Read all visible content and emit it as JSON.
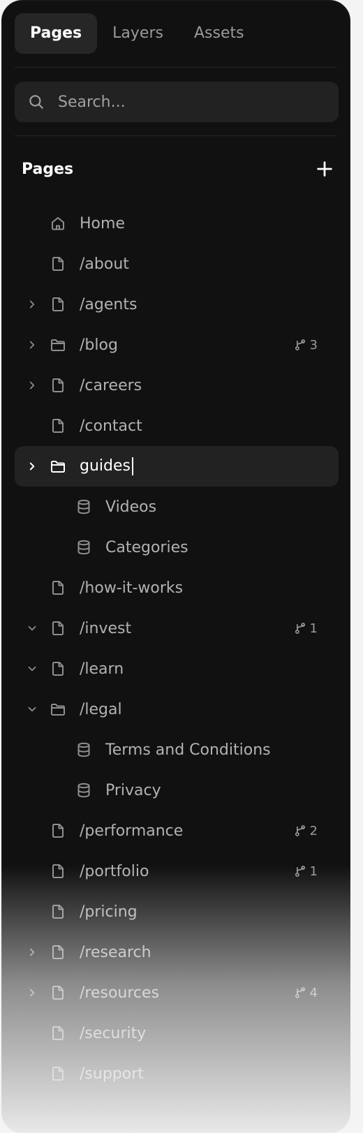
{
  "tabs": {
    "pages": "Pages",
    "layers": "Layers",
    "assets": "Assets"
  },
  "search": {
    "placeholder": "Search..."
  },
  "section": {
    "title": "Pages"
  },
  "items": {
    "home": {
      "label": "Home"
    },
    "about": {
      "label": "/about"
    },
    "agents": {
      "label": "/agents"
    },
    "blog": {
      "label": "/blog",
      "badge": "3"
    },
    "careers": {
      "label": "/careers"
    },
    "contact": {
      "label": "/contact"
    },
    "guides": {
      "label": "guides"
    },
    "videos": {
      "label": "Videos"
    },
    "categories": {
      "label": "Categories"
    },
    "how_it_works": {
      "label": "/how-it-works"
    },
    "invest": {
      "label": "/invest",
      "badge": "1"
    },
    "learn": {
      "label": "/learn"
    },
    "legal": {
      "label": "/legal"
    },
    "terms": {
      "label": "Terms and Conditions"
    },
    "privacy": {
      "label": "Privacy"
    },
    "performance": {
      "label": "/performance",
      "badge": "2"
    },
    "portfolio": {
      "label": "/portfolio",
      "badge": "1"
    },
    "pricing": {
      "label": "/pricing"
    },
    "research": {
      "label": "/research"
    },
    "resources": {
      "label": "/resources",
      "badge": "4"
    },
    "security": {
      "label": "/security"
    },
    "support": {
      "label": "/support"
    }
  },
  "icons": {
    "tab_active": "#262626",
    "accent_text": "#ffffff",
    "muted_text": "#b2b2b2"
  }
}
